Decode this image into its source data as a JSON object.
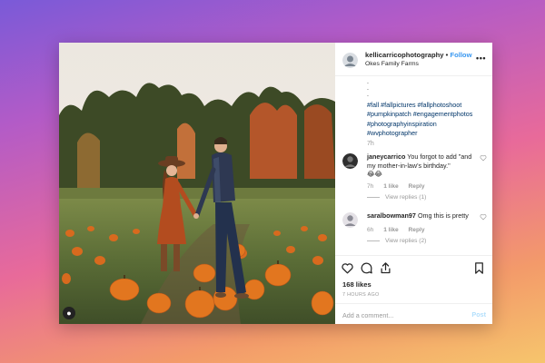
{
  "post": {
    "username": "kellicarricophotography",
    "separator": "•",
    "follow_label": "Follow",
    "location": "Okes Family Farms",
    "more_icon": "more-horizontal-icon",
    "caption_dots": [
      ".",
      ".",
      "."
    ],
    "hashtags": "#fall #fallpictures #fallphotoshoot #pumpkinpatch #engagementphotos #photographyinspiration #wvphotographer",
    "caption_time": "7h",
    "comments": [
      {
        "username": "janeycarrico",
        "text": "You forgot to add \"and my mother-in-law's birthday.\"",
        "emoji": "😂😂",
        "time": "7h",
        "likes": "1 like",
        "reply_label": "Reply",
        "view_replies": "View replies (1)"
      },
      {
        "username": "saralbowman97",
        "text": "Omg this is pretty",
        "emoji": "",
        "time": "6h",
        "likes": "1 like",
        "reply_label": "Reply",
        "view_replies": "View replies (2)"
      }
    ],
    "likes_count": "168 likes",
    "timestamp": "7 HOURS AGO",
    "add_comment_placeholder": "Add a comment...",
    "post_label": "Post",
    "colors": {
      "link": "#003569",
      "follow": "#3897f0",
      "post_disabled": "#b2dffc",
      "muted": "#999999"
    }
  }
}
